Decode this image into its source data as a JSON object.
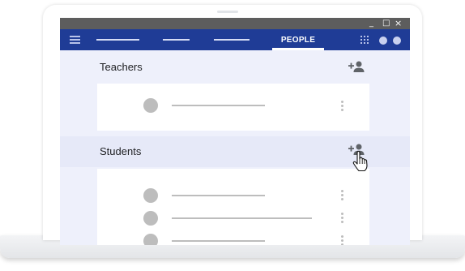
{
  "app": {
    "window_controls": {
      "minimize": "_",
      "maximize": "□",
      "close": "×"
    },
    "nav": {
      "active_tab_label": "PEOPLE"
    }
  },
  "sections": {
    "teachers": {
      "title": "Teachers",
      "add_icon": "add-person-icon"
    },
    "students": {
      "title": "Students",
      "add_icon": "add-person-icon"
    }
  },
  "colors": {
    "appbar": "#1f3c96",
    "titlebar": "#5d5d5d",
    "screen_bg": "#eef0fb",
    "placeholder_gray": "#bdbdbd"
  },
  "icons": [
    "menu-icon",
    "apps-grid-icon",
    "add-person-icon",
    "more-vert-icon",
    "hand-pointer-cursor-icon"
  ]
}
